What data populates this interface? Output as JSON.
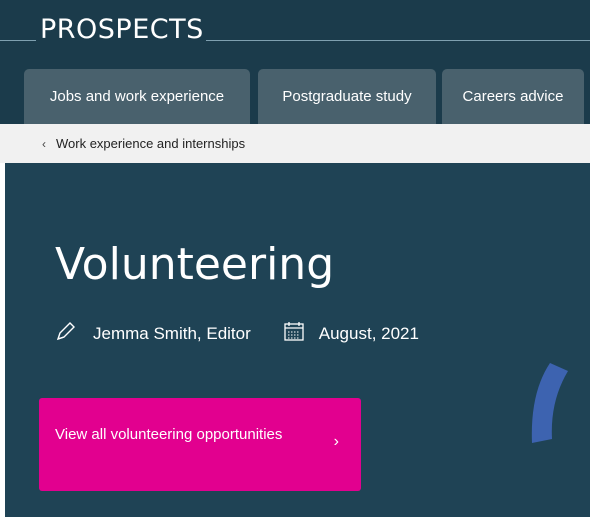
{
  "header": {
    "logo_text": "PROSPECTS",
    "tabs": [
      {
        "label": "Jobs and work experience"
      },
      {
        "label": "Postgraduate study"
      },
      {
        "label": "Careers advice"
      }
    ]
  },
  "breadcrumb": {
    "label": "Work experience and internships",
    "icon": "chevron-left-icon"
  },
  "article": {
    "title": "Volunteering",
    "author": "Jemma Smith, Editor",
    "date": "August, 2021",
    "author_icon": "pencil-icon",
    "date_icon": "calendar-icon"
  },
  "cta": {
    "label": "View all volunteering opportunities",
    "icon": "chevron-right-icon"
  },
  "colors": {
    "header_bg": "#1b3b4b",
    "tab_bg": "#49616d",
    "hero_bg": "#1f4355",
    "cta_bg": "#e2008f",
    "accent_arc": "#3d63b0"
  }
}
